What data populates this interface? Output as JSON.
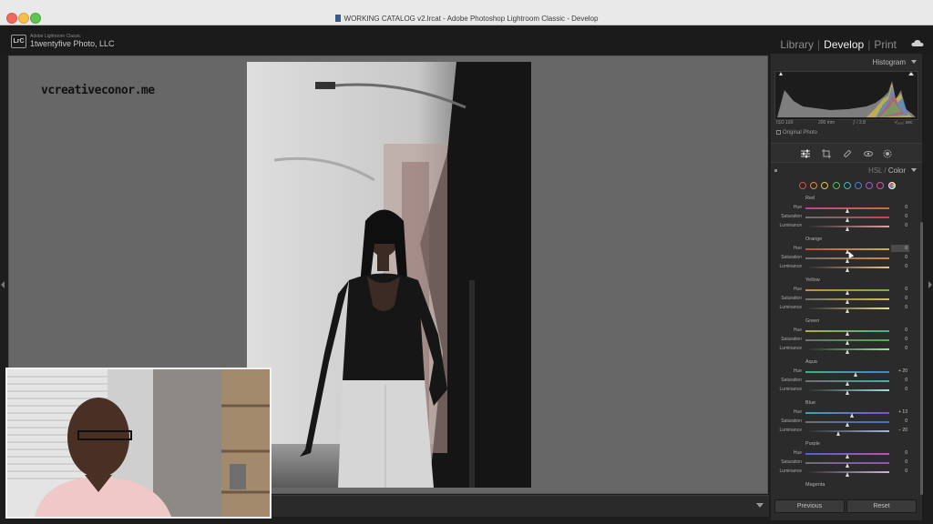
{
  "window": {
    "title": "WORKING CATALOG v2.lrcat - Adobe Photoshop Lightroom Classic - Develop"
  },
  "identity": {
    "app_small": "Adobe Lightroom Classic",
    "name": "1twentyfive Photo, LLC",
    "logo_text": "LrC"
  },
  "modules": {
    "library": "Library",
    "develop": "Develop",
    "print": "Print",
    "active": "Develop",
    "separator": "|"
  },
  "canvas": {
    "watermark": "vcreativeconor.me"
  },
  "histogram": {
    "title": "Histogram",
    "iso": "ISO 100",
    "focal": "200 mm",
    "aperture": "ƒ / 2.8",
    "shutter": "¹⁄₁₀₀₀ sec",
    "original_photo": "Original Photo"
  },
  "hsl": {
    "title_hsl": "HSL",
    "title_sep": " / ",
    "title_color": "Color",
    "swatch_colors": [
      "#d94b4b",
      "#e08a3a",
      "#d8c84a",
      "#5db85a",
      "#45b6b6",
      "#4a7bd6",
      "#9b5bd6",
      "#d653b3",
      "#e6e6e6"
    ],
    "groups": [
      {
        "name": "Red",
        "rows": [
          {
            "label": "Hue",
            "value": "0",
            "pos": 0.5,
            "from": "#c0428c",
            "to": "#d06a3a"
          },
          {
            "label": "Saturation",
            "value": "0",
            "pos": 0.5,
            "from": "#6e6e6e",
            "to": "#c84545"
          },
          {
            "label": "Luminance",
            "value": "0",
            "pos": 0.5,
            "from": "#2a2a2a",
            "to": "#e0a0a0"
          }
        ]
      },
      {
        "name": "Orange",
        "rows": [
          {
            "label": "Hue",
            "value": "0",
            "pos": 0.5,
            "from": "#c84a3a",
            "to": "#c8b240",
            "highlight": true
          },
          {
            "label": "Saturation",
            "value": "0",
            "pos": 0.5,
            "from": "#6e6e6e",
            "to": "#d8873a"
          },
          {
            "label": "Luminance",
            "value": "0",
            "pos": 0.5,
            "from": "#2a2a2a",
            "to": "#e8c090"
          }
        ]
      },
      {
        "name": "Yellow",
        "rows": [
          {
            "label": "Hue",
            "value": "0",
            "pos": 0.5,
            "from": "#d08a3a",
            "to": "#7ab040"
          },
          {
            "label": "Saturation",
            "value": "0",
            "pos": 0.5,
            "from": "#6e6e6e",
            "to": "#d4c040"
          },
          {
            "label": "Luminance",
            "value": "0",
            "pos": 0.5,
            "from": "#2a2a2a",
            "to": "#e8e090"
          }
        ]
      },
      {
        "name": "Green",
        "rows": [
          {
            "label": "Hue",
            "value": "0",
            "pos": 0.5,
            "from": "#b0b040",
            "to": "#40b090"
          },
          {
            "label": "Saturation",
            "value": "0",
            "pos": 0.5,
            "from": "#6e6e6e",
            "to": "#50b050"
          },
          {
            "label": "Luminance",
            "value": "0",
            "pos": 0.5,
            "from": "#2a2a2a",
            "to": "#a0e0a0"
          }
        ]
      },
      {
        "name": "Aqua",
        "rows": [
          {
            "label": "Hue",
            "value": "+ 20",
            "pos": 0.6,
            "from": "#40b080",
            "to": "#4a80d0"
          },
          {
            "label": "Saturation",
            "value": "0",
            "pos": 0.5,
            "from": "#6e6e6e",
            "to": "#40b0b0"
          },
          {
            "label": "Luminance",
            "value": "0",
            "pos": 0.5,
            "from": "#2a2a2a",
            "to": "#a0e0e0"
          }
        ]
      },
      {
        "name": "Blue",
        "rows": [
          {
            "label": "Hue",
            "value": "+ 13",
            "pos": 0.565,
            "from": "#40a0b0",
            "to": "#8050d0"
          },
          {
            "label": "Saturation",
            "value": "0",
            "pos": 0.5,
            "from": "#6e6e6e",
            "to": "#4070d0"
          },
          {
            "label": "Luminance",
            "value": "− 20",
            "pos": 0.4,
            "from": "#2a2a2a",
            "to": "#a0b8e8"
          }
        ]
      },
      {
        "name": "Purple",
        "rows": [
          {
            "label": "Hue",
            "value": "0",
            "pos": 0.5,
            "from": "#5060d0",
            "to": "#c050b0"
          },
          {
            "label": "Saturation",
            "value": "0",
            "pos": 0.5,
            "from": "#6e6e6e",
            "to": "#9050d0"
          },
          {
            "label": "Luminance",
            "value": "0",
            "pos": 0.5,
            "from": "#2a2a2a",
            "to": "#d0b0e8"
          }
        ]
      },
      {
        "name": "Magenta",
        "rows": []
      }
    ]
  },
  "buttons": {
    "previous": "Previous",
    "reset": "Reset"
  }
}
